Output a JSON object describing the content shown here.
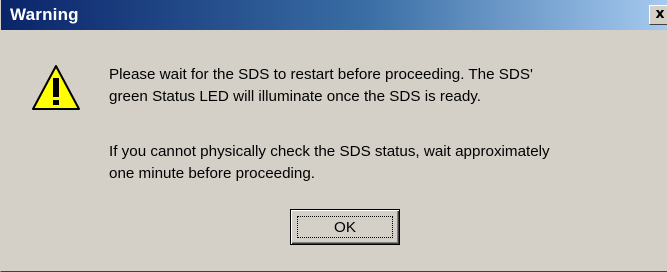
{
  "window": {
    "title": "Warning",
    "close_label": "x"
  },
  "message": {
    "line1": "Please wait for the SDS to restart before proceeding.  The SDS'",
    "line2": "green Status LED will illuminate once the SDS is ready.",
    "line3": "If you cannot physically check the SDS status, wait approximately",
    "line4": "one minute before proceeding."
  },
  "buttons": {
    "ok_label": "OK"
  },
  "icon": {
    "name": "warning-icon",
    "color": "#ffff00"
  }
}
